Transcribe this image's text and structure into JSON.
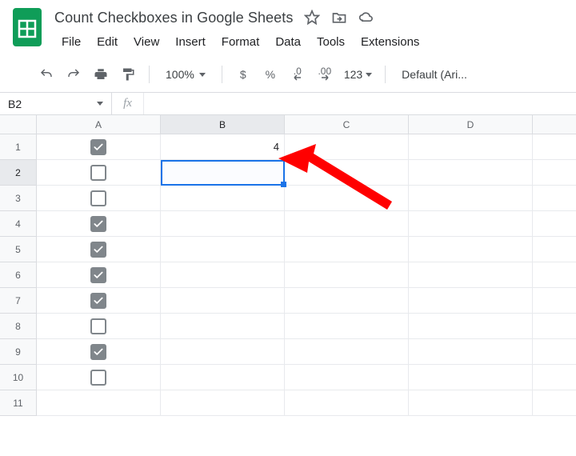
{
  "doc": {
    "title": "Count Checkboxes in Google Sheets"
  },
  "menu": {
    "file": "File",
    "edit": "Edit",
    "view": "View",
    "insert": "Insert",
    "format": "Format",
    "data": "Data",
    "tools": "Tools",
    "extensions": "Extensions"
  },
  "toolbar": {
    "zoom": "100%",
    "currency": "$",
    "percent": "%",
    "dec_dec": ".0",
    "inc_dec": ".00",
    "num_fmt": "123",
    "font": "Default (Ari..."
  },
  "fx": {
    "name_box": "B2",
    "label": "fx",
    "formula": ""
  },
  "grid": {
    "columns": [
      "A",
      "B",
      "C",
      "D",
      ""
    ],
    "selected_col": "B",
    "selected_row": 2,
    "rows": [
      {
        "n": 1,
        "A": {
          "type": "checkbox",
          "checked": true
        },
        "B": {
          "type": "number",
          "value": "4"
        }
      },
      {
        "n": 2,
        "A": {
          "type": "checkbox",
          "checked": false
        }
      },
      {
        "n": 3,
        "A": {
          "type": "checkbox",
          "checked": false
        }
      },
      {
        "n": 4,
        "A": {
          "type": "checkbox",
          "checked": true
        }
      },
      {
        "n": 5,
        "A": {
          "type": "checkbox",
          "checked": true
        }
      },
      {
        "n": 6,
        "A": {
          "type": "checkbox",
          "checked": true
        }
      },
      {
        "n": 7,
        "A": {
          "type": "checkbox",
          "checked": true
        }
      },
      {
        "n": 8,
        "A": {
          "type": "checkbox",
          "checked": false
        }
      },
      {
        "n": 9,
        "A": {
          "type": "checkbox",
          "checked": true
        }
      },
      {
        "n": 10,
        "A": {
          "type": "checkbox",
          "checked": false
        }
      },
      {
        "n": 11
      }
    ]
  }
}
